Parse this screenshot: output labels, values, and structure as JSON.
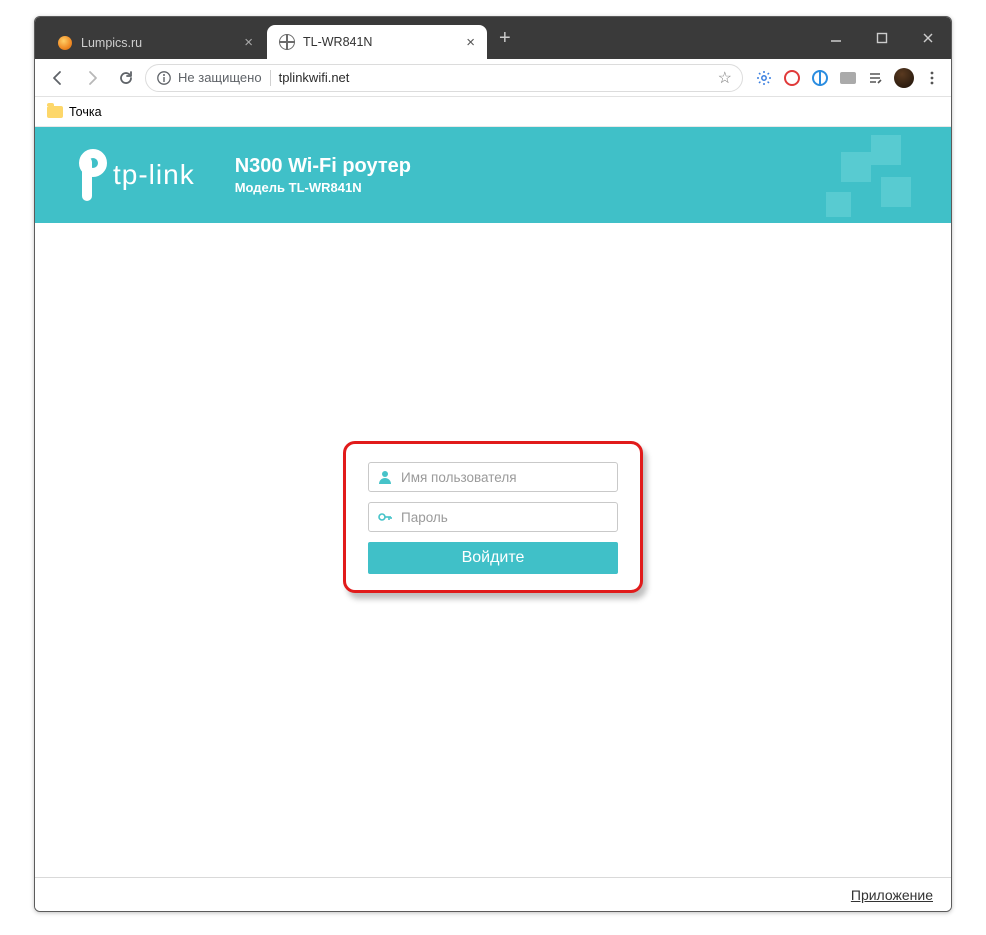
{
  "window": {
    "tabs": [
      {
        "title": "Lumpics.ru",
        "active": false
      },
      {
        "title": "TL-WR841N",
        "active": true
      }
    ]
  },
  "urlbar": {
    "insecure_label": "Не защищено",
    "url": "tplinkwifi.net"
  },
  "bookmarks": {
    "items": [
      {
        "label": "Точка"
      }
    ]
  },
  "banner": {
    "brand": "tp-link",
    "title": "N300 Wi-Fi роутер",
    "subtitle": "Модель TL-WR841N"
  },
  "login": {
    "username_placeholder": "Имя пользователя",
    "password_placeholder": "Пароль",
    "submit_label": "Войдите"
  },
  "footer": {
    "app_link": "Приложение"
  }
}
